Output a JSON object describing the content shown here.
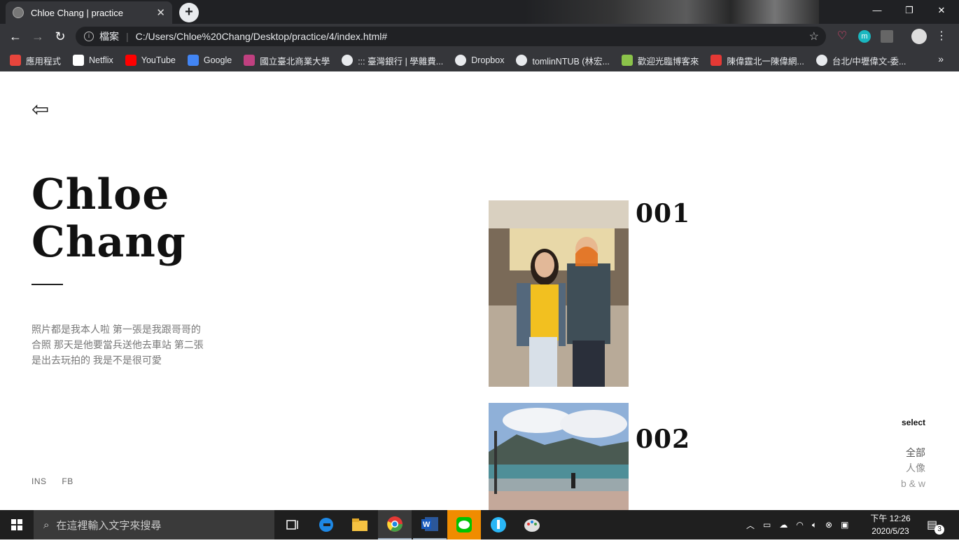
{
  "browser": {
    "tab_title": "Chloe Chang | practice",
    "tab_close": "✕",
    "new_tab": "+",
    "address_label": "檔案",
    "url": "C:/Users/Chloe%20Chang/Desktop/practice/4/index.html#",
    "window_controls": {
      "minimize": "—",
      "maximize": "❐",
      "close": "✕"
    },
    "bookmarks": [
      {
        "label": "應用程式",
        "icon": "apps-grid-icon",
        "color": "#e8453c"
      },
      {
        "label": "Netflix",
        "icon": "netflix-icon",
        "color": "#ffffff"
      },
      {
        "label": "YouTube",
        "icon": "youtube-icon",
        "color": "#ff0000"
      },
      {
        "label": "Google",
        "icon": "google-icon",
        "color": "#4285f4"
      },
      {
        "label": "國立臺北商業大學",
        "icon": "ntub-icon",
        "color": "#c04080"
      },
      {
        "label": "::: 臺灣銀行 | 學雜費...",
        "icon": "globe-icon",
        "color": "#e8eaed"
      },
      {
        "label": "Dropbox",
        "icon": "globe-icon",
        "color": "#e8eaed"
      },
      {
        "label": "tomlinNTUB (林宏...",
        "icon": "github-icon",
        "color": "#e8eaed"
      },
      {
        "label": "歡迎光臨博客來",
        "icon": "books-icon",
        "color": "#8bc34a"
      },
      {
        "label": "陳偉霆北一陳偉網...",
        "icon": "bookmark-red-icon",
        "color": "#e53935"
      },
      {
        "label": "台北/中壢偉文-委...",
        "icon": "globe-icon",
        "color": "#e8eaed"
      }
    ],
    "bookmarks_more": "»"
  },
  "page": {
    "back_arrow": "⇦",
    "name_line1": "Chloe",
    "name_line2": "Chang",
    "description": "照片都是我本人啦 第一張是我跟哥哥的合照 那天是他要當兵送他去車站 第二張是出去玩拍的 我是不是很可愛",
    "social": [
      "INS",
      "FB"
    ],
    "photos": [
      {
        "number": "001"
      },
      {
        "number": "002"
      }
    ],
    "select_title": "select",
    "filters": [
      "全部",
      "人像",
      "b & w"
    ]
  },
  "taskbar": {
    "search_placeholder": "在這裡輸入文字來搜尋",
    "clock_line1": "下午 12:26",
    "clock_line2": "2020/5/23",
    "notification_count": "3"
  }
}
